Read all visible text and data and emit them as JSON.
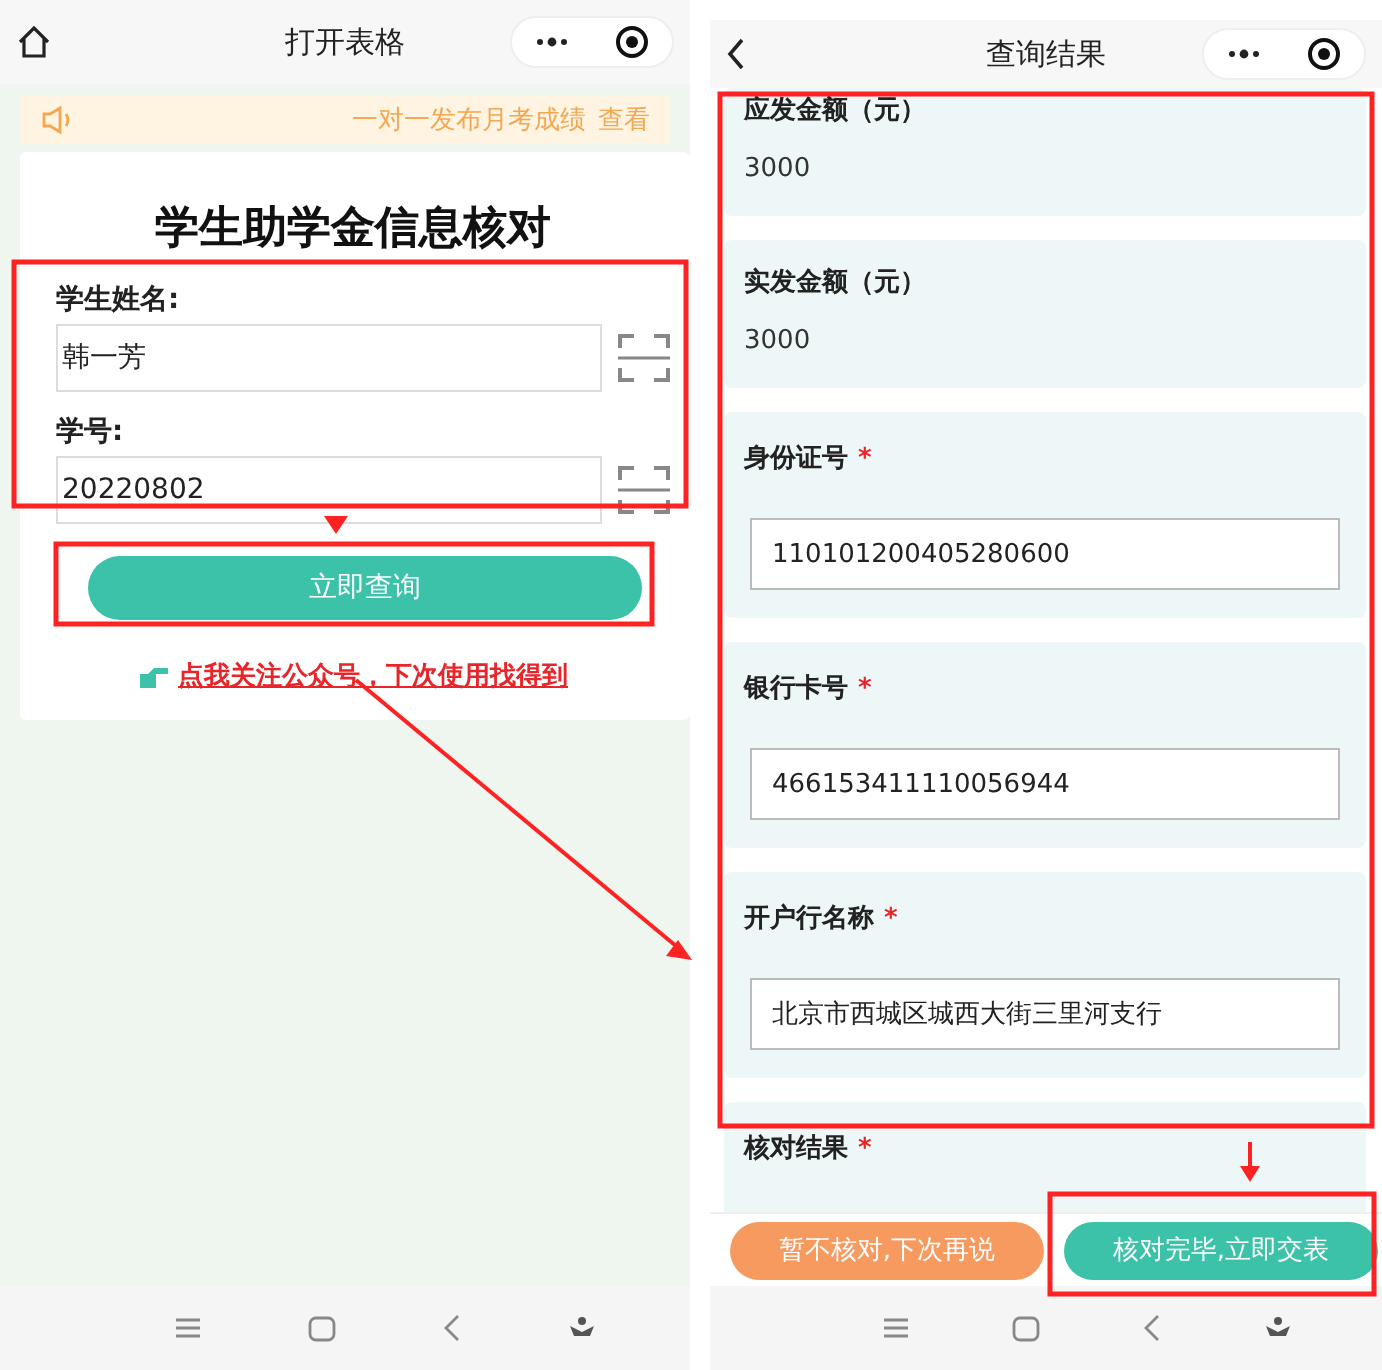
{
  "left_screen": {
    "header": {
      "title": "打开表格"
    },
    "notice": {
      "text": "一对一发布月考成绩",
      "link": "查看"
    },
    "form": {
      "title": "学生助学金信息核对",
      "fields": [
        {
          "label": "学生姓名:",
          "value": "韩一芳"
        },
        {
          "label": "学号:",
          "value": "20220802"
        }
      ],
      "submit": "立即查询",
      "follow_link": "点我关注公众号，下次使用找得到"
    }
  },
  "right_screen": {
    "header": {
      "title": "查询结果"
    },
    "cards": [
      {
        "kind": "text",
        "label": "应发金额（元）",
        "value": "3000"
      },
      {
        "kind": "text",
        "label": "实发金额（元）",
        "value": "3000"
      },
      {
        "kind": "input",
        "label": "身份证号",
        "mark": "*",
        "value": "110101200405280600"
      },
      {
        "kind": "input",
        "label": "银行卡号",
        "mark": "*",
        "value": "466153411110056944"
      },
      {
        "kind": "input",
        "label": "开户行名称",
        "mark": "*",
        "value": "北京市西城区城西大街三里河支行"
      },
      {
        "kind": "partial",
        "label": "核对结果",
        "mark": "*"
      }
    ],
    "buttons": [
      {
        "kind": "secondary",
        "label": "暂不核对,下次再说"
      },
      {
        "kind": "primary",
        "label": "核对完毕,立即交表"
      }
    ]
  }
}
